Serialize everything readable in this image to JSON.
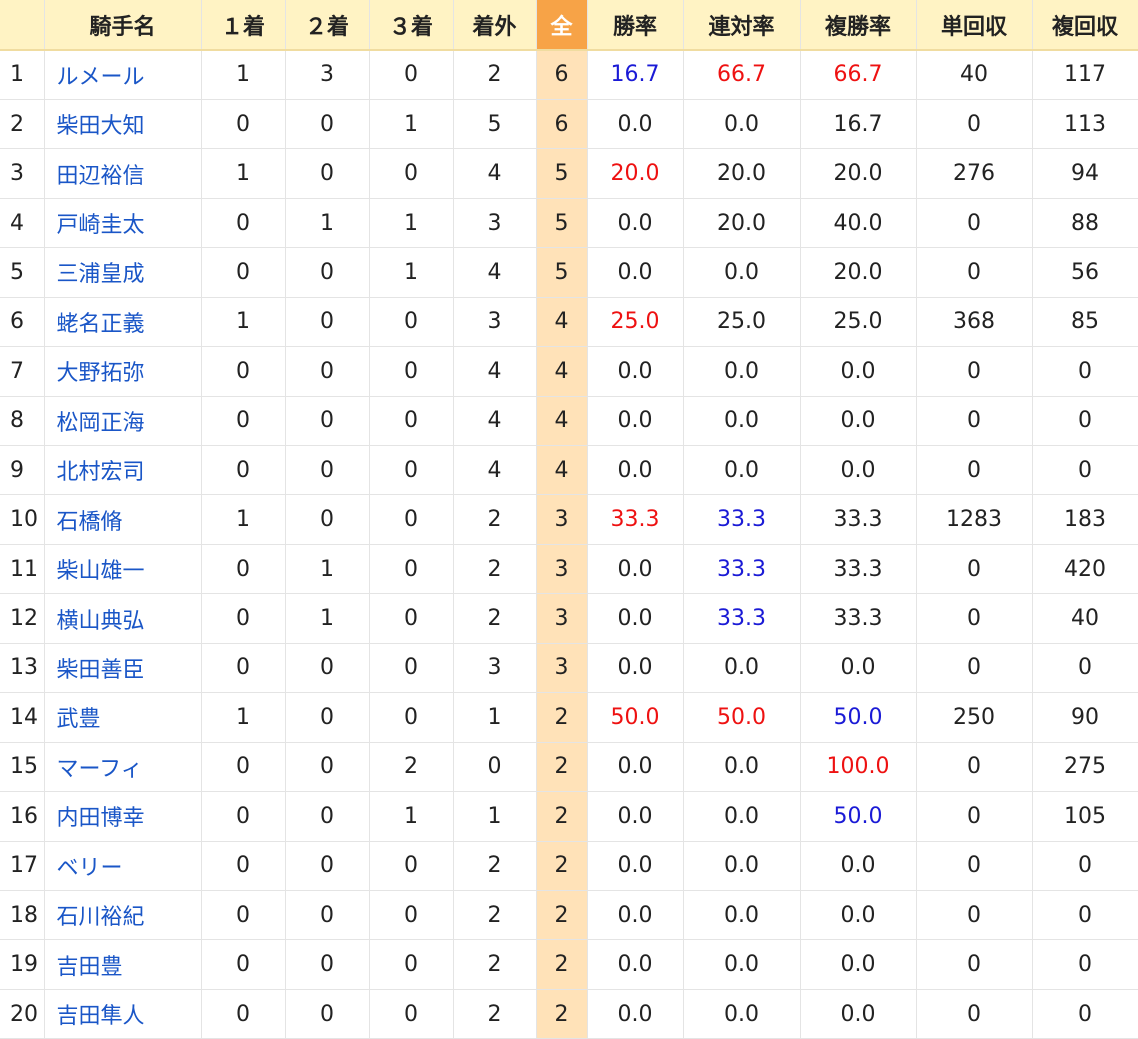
{
  "headers": [
    "",
    "騎手名",
    "１着",
    "２着",
    "３着",
    "着外",
    "全",
    "勝率",
    "連対率",
    "複勝率",
    "単回収",
    "複回収"
  ],
  "colors": {
    "header_bg": "#fff3c4",
    "total_header_bg": "#f7a347",
    "total_cell_bg": "#ffe2b8",
    "link": "#1a56c7",
    "highlight_red": "#ee1111",
    "highlight_blue": "#1a1ad6"
  },
  "rows": [
    {
      "rank": "1",
      "name": "ルメール",
      "first": "1",
      "second": "3",
      "third": "0",
      "out": "2",
      "total": "6",
      "win": "16.7",
      "rentai": "66.7",
      "fukusho": "66.7",
      "tan": "40",
      "fuku": "117",
      "win_hl": "blue",
      "rentai_hl": "red",
      "fukusho_hl": "red"
    },
    {
      "rank": "2",
      "name": "柴田大知",
      "first": "0",
      "second": "0",
      "third": "1",
      "out": "5",
      "total": "6",
      "win": "0.0",
      "rentai": "0.0",
      "fukusho": "16.7",
      "tan": "0",
      "fuku": "113",
      "win_hl": "",
      "rentai_hl": "",
      "fukusho_hl": ""
    },
    {
      "rank": "3",
      "name": "田辺裕信",
      "first": "1",
      "second": "0",
      "third": "0",
      "out": "4",
      "total": "5",
      "win": "20.0",
      "rentai": "20.0",
      "fukusho": "20.0",
      "tan": "276",
      "fuku": "94",
      "win_hl": "red",
      "rentai_hl": "",
      "fukusho_hl": ""
    },
    {
      "rank": "4",
      "name": "戸崎圭太",
      "first": "0",
      "second": "1",
      "third": "1",
      "out": "3",
      "total": "5",
      "win": "0.0",
      "rentai": "20.0",
      "fukusho": "40.0",
      "tan": "0",
      "fuku": "88",
      "win_hl": "",
      "rentai_hl": "",
      "fukusho_hl": ""
    },
    {
      "rank": "5",
      "name": "三浦皇成",
      "first": "0",
      "second": "0",
      "third": "1",
      "out": "4",
      "total": "5",
      "win": "0.0",
      "rentai": "0.0",
      "fukusho": "20.0",
      "tan": "0",
      "fuku": "56",
      "win_hl": "",
      "rentai_hl": "",
      "fukusho_hl": ""
    },
    {
      "rank": "6",
      "name": "蛯名正義",
      "first": "1",
      "second": "0",
      "third": "0",
      "out": "3",
      "total": "4",
      "win": "25.0",
      "rentai": "25.0",
      "fukusho": "25.0",
      "tan": "368",
      "fuku": "85",
      "win_hl": "red",
      "rentai_hl": "",
      "fukusho_hl": ""
    },
    {
      "rank": "7",
      "name": "大野拓弥",
      "first": "0",
      "second": "0",
      "third": "0",
      "out": "4",
      "total": "4",
      "win": "0.0",
      "rentai": "0.0",
      "fukusho": "0.0",
      "tan": "0",
      "fuku": "0",
      "win_hl": "",
      "rentai_hl": "",
      "fukusho_hl": ""
    },
    {
      "rank": "8",
      "name": "松岡正海",
      "first": "0",
      "second": "0",
      "third": "0",
      "out": "4",
      "total": "4",
      "win": "0.0",
      "rentai": "0.0",
      "fukusho": "0.0",
      "tan": "0",
      "fuku": "0",
      "win_hl": "",
      "rentai_hl": "",
      "fukusho_hl": ""
    },
    {
      "rank": "9",
      "name": "北村宏司",
      "first": "0",
      "second": "0",
      "third": "0",
      "out": "4",
      "total": "4",
      "win": "0.0",
      "rentai": "0.0",
      "fukusho": "0.0",
      "tan": "0",
      "fuku": "0",
      "win_hl": "",
      "rentai_hl": "",
      "fukusho_hl": ""
    },
    {
      "rank": "10",
      "name": "石橋脩",
      "first": "1",
      "second": "0",
      "third": "0",
      "out": "2",
      "total": "3",
      "win": "33.3",
      "rentai": "33.3",
      "fukusho": "33.3",
      "tan": "1283",
      "fuku": "183",
      "win_hl": "red",
      "rentai_hl": "blue",
      "fukusho_hl": ""
    },
    {
      "rank": "11",
      "name": "柴山雄一",
      "first": "0",
      "second": "1",
      "third": "0",
      "out": "2",
      "total": "3",
      "win": "0.0",
      "rentai": "33.3",
      "fukusho": "33.3",
      "tan": "0",
      "fuku": "420",
      "win_hl": "",
      "rentai_hl": "blue",
      "fukusho_hl": ""
    },
    {
      "rank": "12",
      "name": "横山典弘",
      "first": "0",
      "second": "1",
      "third": "0",
      "out": "2",
      "total": "3",
      "win": "0.0",
      "rentai": "33.3",
      "fukusho": "33.3",
      "tan": "0",
      "fuku": "40",
      "win_hl": "",
      "rentai_hl": "blue",
      "fukusho_hl": ""
    },
    {
      "rank": "13",
      "name": "柴田善臣",
      "first": "0",
      "second": "0",
      "third": "0",
      "out": "3",
      "total": "3",
      "win": "0.0",
      "rentai": "0.0",
      "fukusho": "0.0",
      "tan": "0",
      "fuku": "0",
      "win_hl": "",
      "rentai_hl": "",
      "fukusho_hl": ""
    },
    {
      "rank": "14",
      "name": "武豊",
      "first": "1",
      "second": "0",
      "third": "0",
      "out": "1",
      "total": "2",
      "win": "50.0",
      "rentai": "50.0",
      "fukusho": "50.0",
      "tan": "250",
      "fuku": "90",
      "win_hl": "red",
      "rentai_hl": "red",
      "fukusho_hl": "blue"
    },
    {
      "rank": "15",
      "name": "マーフィ",
      "first": "0",
      "second": "0",
      "third": "2",
      "out": "0",
      "total": "2",
      "win": "0.0",
      "rentai": "0.0",
      "fukusho": "100.0",
      "tan": "0",
      "fuku": "275",
      "win_hl": "",
      "rentai_hl": "",
      "fukusho_hl": "red"
    },
    {
      "rank": "16",
      "name": "内田博幸",
      "first": "0",
      "second": "0",
      "third": "1",
      "out": "1",
      "total": "2",
      "win": "0.0",
      "rentai": "0.0",
      "fukusho": "50.0",
      "tan": "0",
      "fuku": "105",
      "win_hl": "",
      "rentai_hl": "",
      "fukusho_hl": "blue"
    },
    {
      "rank": "17",
      "name": "ベリー",
      "first": "0",
      "second": "0",
      "third": "0",
      "out": "2",
      "total": "2",
      "win": "0.0",
      "rentai": "0.0",
      "fukusho": "0.0",
      "tan": "0",
      "fuku": "0",
      "win_hl": "",
      "rentai_hl": "",
      "fukusho_hl": ""
    },
    {
      "rank": "18",
      "name": "石川裕紀",
      "first": "0",
      "second": "0",
      "third": "0",
      "out": "2",
      "total": "2",
      "win": "0.0",
      "rentai": "0.0",
      "fukusho": "0.0",
      "tan": "0",
      "fuku": "0",
      "win_hl": "",
      "rentai_hl": "",
      "fukusho_hl": ""
    },
    {
      "rank": "19",
      "name": "吉田豊",
      "first": "0",
      "second": "0",
      "third": "0",
      "out": "2",
      "total": "2",
      "win": "0.0",
      "rentai": "0.0",
      "fukusho": "0.0",
      "tan": "0",
      "fuku": "0",
      "win_hl": "",
      "rentai_hl": "",
      "fukusho_hl": ""
    },
    {
      "rank": "20",
      "name": "吉田隼人",
      "first": "0",
      "second": "0",
      "third": "0",
      "out": "2",
      "total": "2",
      "win": "0.0",
      "rentai": "0.0",
      "fukusho": "0.0",
      "tan": "0",
      "fuku": "0",
      "win_hl": "",
      "rentai_hl": "",
      "fukusho_hl": ""
    }
  ]
}
